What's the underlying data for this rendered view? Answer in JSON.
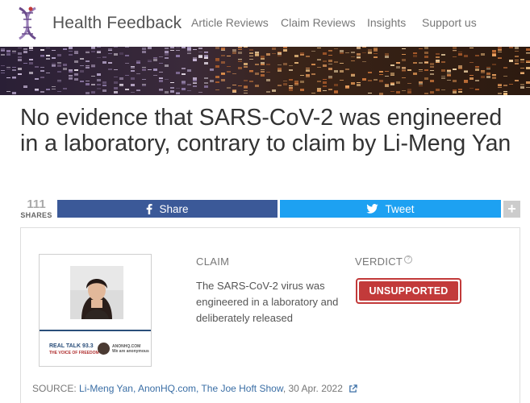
{
  "brand": {
    "name": "Health Feedback"
  },
  "nav": {
    "items": [
      {
        "label": "Article Reviews"
      },
      {
        "label": "Claim Reviews"
      },
      {
        "label": "Insights"
      },
      {
        "label": "Support us"
      }
    ]
  },
  "article": {
    "title": "No evidence that SARS-CoV-2 was engineered in a laboratory, contrary to claim by Li-Meng Yan"
  },
  "share_bar": {
    "count": "111",
    "count_label": "SHARES",
    "share_label": "Share",
    "tweet_label": "Tweet",
    "more_label": "+"
  },
  "claim_card": {
    "claim_heading": "CLAIM",
    "claim_text": "The SARS-CoV-2 virus was engineered in a laboratory and deliberately released",
    "verdict_heading": "VERDICT",
    "verdict_help": "?",
    "verdict_label": "UNSUPPORTED",
    "thumbnail_logos": {
      "left": "REAL TALK 93.3",
      "left_sub": "THE VOICE OF FREEDOM",
      "right": "ANONHQ.COM",
      "right_sub": "We are anonymous"
    },
    "source_prefix": "SOURCE: ",
    "source_links": "Li-Meng Yan, AnonHQ.com, The Joe Hoft Show",
    "source_date": ", 30 Apr. 2022"
  },
  "colors": {
    "facebook": "#3b5998",
    "twitter": "#1da1f2",
    "verdict_red": "#c23a3a",
    "link_blue": "#3a6ea5",
    "brand_purple": "#6b4c8c"
  },
  "icons": {
    "logo": "dna-helix-icon",
    "share": "facebook-icon",
    "tweet": "twitter-bird-icon",
    "more": "plus-icon",
    "help": "question-circle-icon",
    "source_link": "external-link-icon"
  }
}
